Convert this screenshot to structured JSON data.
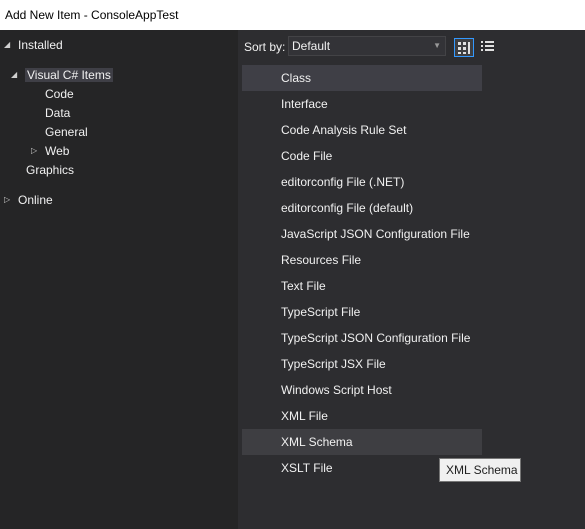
{
  "window": {
    "title": "Add New Item - ConsoleAppTest"
  },
  "tree": {
    "installed": "Installed",
    "visual_csharp": "Visual C# Items",
    "code": "Code",
    "data": "Data",
    "general": "General",
    "web": "Web",
    "graphics": "Graphics",
    "online": "Online"
  },
  "sort": {
    "label": "Sort by:",
    "value": "Default"
  },
  "view_buttons": {
    "medium_icons": "medium-icons-view-icon",
    "list": "list-view-icon"
  },
  "items": [
    "Class",
    "Interface",
    "Code Analysis Rule Set",
    "Code File",
    "editorconfig File (.NET)",
    "editorconfig File (default)",
    "JavaScript JSON Configuration File",
    "Resources File",
    "Text File",
    "TypeScript File",
    "TypeScript JSON Configuration File",
    "TypeScript JSX File",
    "Windows Script Host",
    "XML File",
    "XML Schema",
    "XSLT File"
  ],
  "tooltip": "XML Schema",
  "colors": {
    "accent": "#3399ff",
    "selected": "#3f3f46",
    "background": "#252526"
  }
}
